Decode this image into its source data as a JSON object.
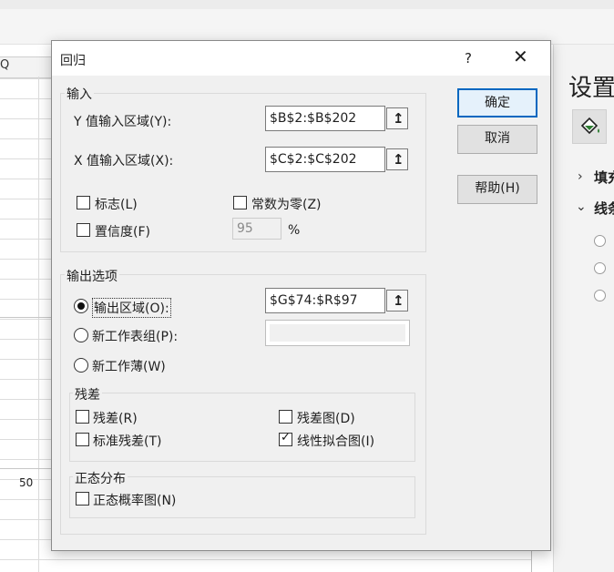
{
  "sheet": {
    "column_header": "Q",
    "axis_label": "50"
  },
  "right_pane": {
    "title": "设置",
    "sections": [
      "填充",
      "线条"
    ]
  },
  "dialog": {
    "title": "回归",
    "help_glyph": "?",
    "close_glyph": "✕",
    "input_group": {
      "label": "输入",
      "y_range_label": "Y 值输入区域(Y):",
      "y_range_value": "$B$2:$B$202",
      "x_range_label": "X 值输入区域(X):",
      "x_range_value": "$C$2:$C$202",
      "labels_cb": "标志(L)",
      "labels_checked": false,
      "constant_zero_cb": "常数为零(Z)",
      "constant_zero_checked": false,
      "confidence_cb": "置信度(F)",
      "confidence_checked": false,
      "confidence_value": "95",
      "percent": "%"
    },
    "output_group": {
      "label": "输出选项",
      "output_range_radio": "输出区域(O):",
      "output_range_value": "$G$74:$R$97",
      "new_sheet_radio": "新工作表组(P):",
      "new_sheet_value": "",
      "new_workbook_radio": "新工作薄(W)",
      "selected": "output_range"
    },
    "residuals_group": {
      "label": "残差",
      "residuals": "残差(R)",
      "residuals_checked": false,
      "residual_plots": "残差图(D)",
      "residual_plots_checked": false,
      "standardized": "标准残差(T)",
      "standardized_checked": false,
      "line_fit": "线性拟合图(I)",
      "line_fit_checked": true
    },
    "normal_group": {
      "label": "正态分布",
      "normal_prob": "正态概率图(N)",
      "normal_prob_checked": false
    },
    "buttons": {
      "ok": "确定",
      "cancel": "取消",
      "help": "帮助(H)"
    },
    "ref_glyph": "↥"
  }
}
